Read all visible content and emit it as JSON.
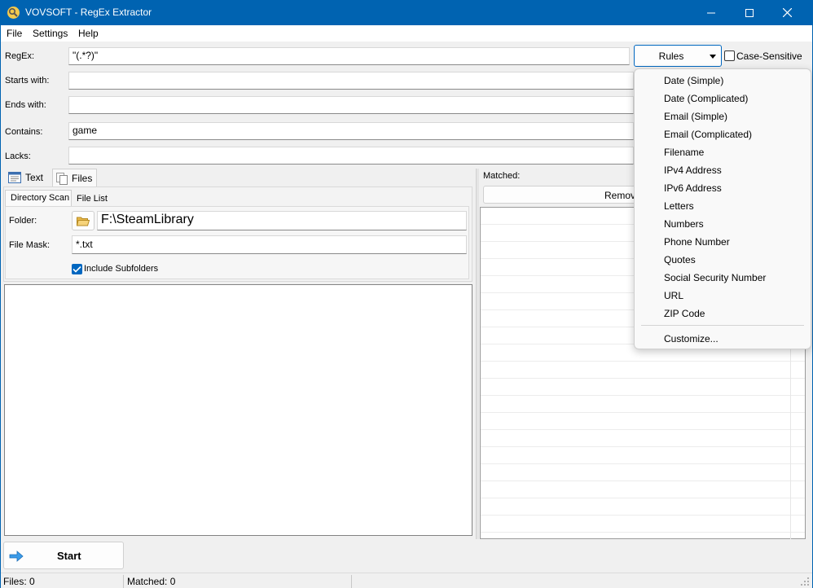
{
  "window": {
    "title": "VOVSOFT - RegEx Extractor"
  },
  "menu": [
    "File",
    "Settings",
    "Help"
  ],
  "filters": {
    "regex_label": "RegEx:",
    "regex_value": "\"(.*?)\"",
    "starts_label": "Starts with:",
    "starts_value": "",
    "ends_label": "Ends with:",
    "ends_value": "",
    "contains_label": "Contains:",
    "contains_value": "game",
    "lacks_label": "Lacks:",
    "lacks_value": ""
  },
  "rules_button": "Rules",
  "case_sensitive": {
    "label": "Case-Sensitive",
    "checked": false
  },
  "tabs": {
    "text": "Text",
    "files": "Files",
    "active": "Files"
  },
  "subtabs": {
    "directory_scan": "Directory Scan",
    "file_list": "File List"
  },
  "directory_scan": {
    "folder_label": "Folder:",
    "folder_value": "F:\\SteamLibrary",
    "mask_label": "File Mask:",
    "mask_value": "*.txt",
    "include_subfolders_label": "Include Subfolders",
    "include_subfolders": true
  },
  "matched": {
    "label": "Matched:",
    "remove_button": "Remove"
  },
  "start_button": "Start",
  "status": {
    "files": "Files: 0",
    "matched": "Matched: 0"
  },
  "rules_menu": {
    "items": [
      "Date (Simple)",
      "Date (Complicated)",
      "Email (Simple)",
      "Email (Complicated)",
      "Filename",
      "IPv4 Address",
      "IPv6 Address",
      "Letters",
      "Numbers",
      "Phone Number",
      "Quotes",
      "Social Security Number",
      "URL",
      "ZIP Code"
    ],
    "customize": "Customize..."
  },
  "colors": {
    "titlebar": "#0063b1",
    "accent": "#0067c0"
  }
}
